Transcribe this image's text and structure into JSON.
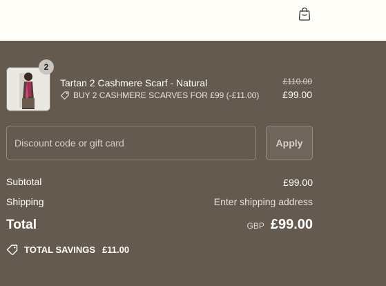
{
  "header": {
    "icon": "shopping-bag-icon"
  },
  "line_item": {
    "name": "Tartan 2 Cashmere Scarf - Natural",
    "quantity": "2",
    "discount_label": "BUY 2 CASHMERE SCARVES FOR £99 (-£11.00)",
    "original_price": "£110.00",
    "price": "£99.00"
  },
  "discount": {
    "placeholder": "Discount code or gift card",
    "apply_label": "Apply"
  },
  "totals": {
    "subtotal_label": "Subtotal",
    "subtotal_value": "£99.00",
    "shipping_label": "Shipping",
    "shipping_value": "Enter shipping address",
    "total_label": "Total",
    "currency": "GBP",
    "total_value": "£99.00",
    "savings_label": "TOTAL SAVINGS",
    "savings_value": "£11.00"
  },
  "colors": {
    "panel_background": "#655a4f",
    "header_background": "#fffdf8"
  }
}
